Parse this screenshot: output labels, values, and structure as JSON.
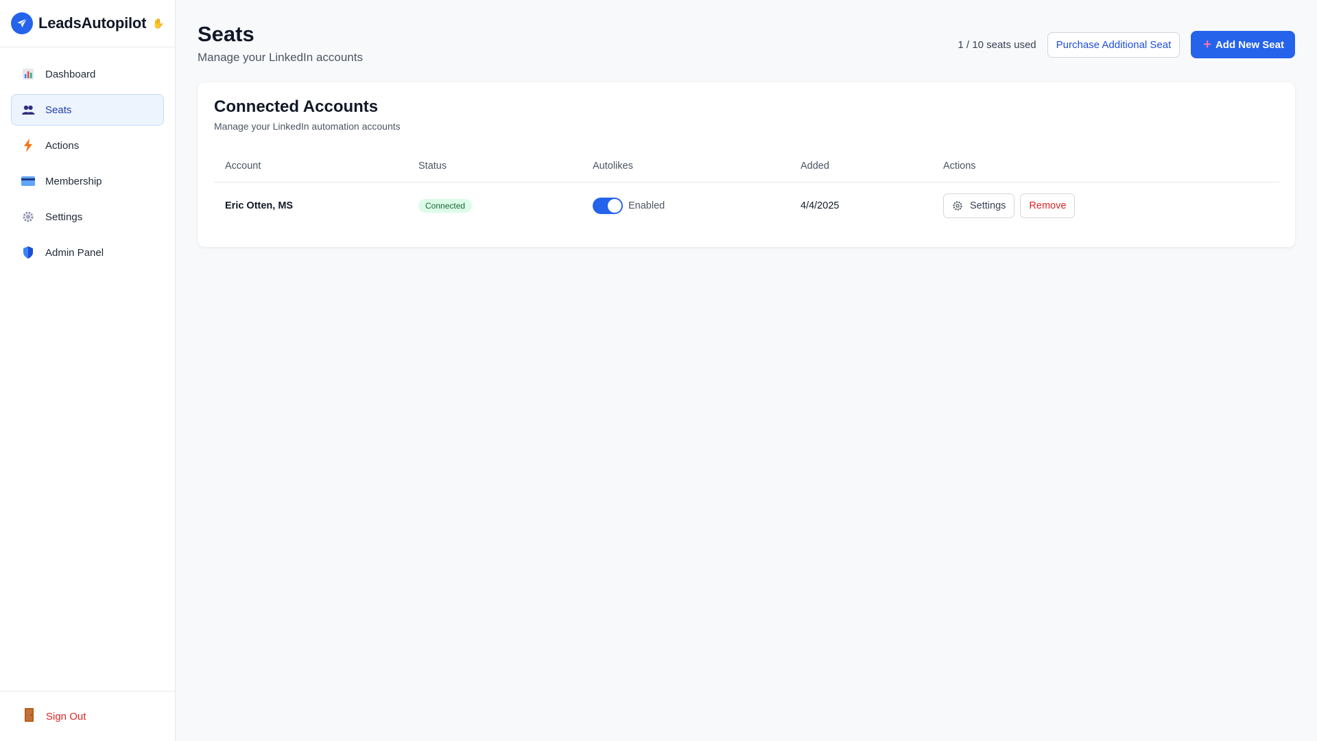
{
  "app": {
    "name": "LeadsAutopilot",
    "badge_icon": "hand-icon",
    "logo_icon": "airplane-icon",
    "brand_color": "#2563eb"
  },
  "sidebar": {
    "items": [
      {
        "label": "Dashboard",
        "icon": "chart-icon",
        "active": false
      },
      {
        "label": "Seats",
        "icon": "users-icon",
        "active": true
      },
      {
        "label": "Actions",
        "icon": "lightning-icon",
        "active": false
      },
      {
        "label": "Membership",
        "icon": "credit-card-icon",
        "active": false
      },
      {
        "label": "Settings",
        "icon": "gear-icon",
        "active": false
      },
      {
        "label": "Admin Panel",
        "icon": "shield-icon",
        "active": false
      }
    ],
    "sign_out": {
      "label": "Sign Out",
      "icon": "door-icon"
    }
  },
  "header": {
    "title": "Seats",
    "subtitle": "Manage your LinkedIn accounts",
    "seats_used": "1 / 10 seats used",
    "purchase_button": "Purchase Additional Seat",
    "add_button": "Add New Seat"
  },
  "accounts_card": {
    "title": "Connected Accounts",
    "subtitle": "Manage your LinkedIn automation accounts",
    "columns": [
      "Account",
      "Status",
      "Autolikes",
      "Added",
      "Actions"
    ],
    "rows": [
      {
        "account": "Eric Otten, MS",
        "status": "Connected",
        "autolikes_enabled": true,
        "autolikes_label": "Enabled",
        "added": "4/4/2025",
        "settings_label": "Settings",
        "remove_label": "Remove"
      }
    ]
  },
  "colors": {
    "accent": "#2563eb",
    "danger": "#dc2626",
    "success_bg": "#dcfce7",
    "success_text": "#166534"
  }
}
